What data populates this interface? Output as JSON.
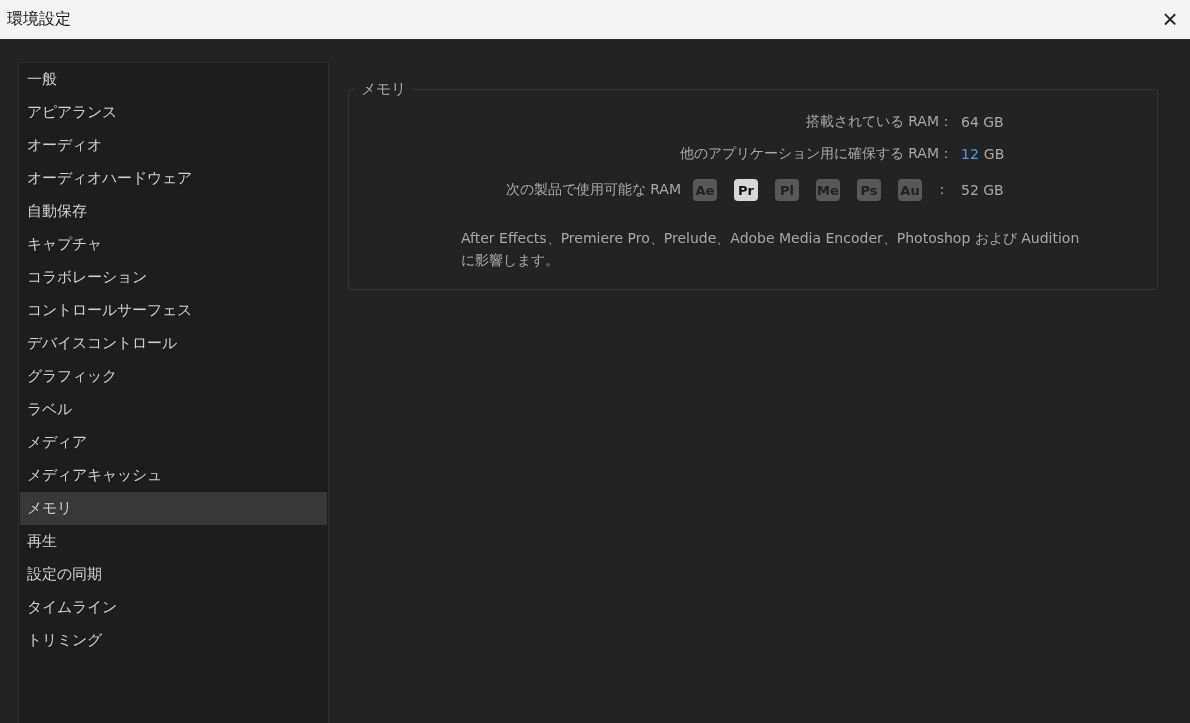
{
  "window": {
    "title": "環境設定",
    "close": "×"
  },
  "sidebar": {
    "items": [
      {
        "label": "一般",
        "selected": false
      },
      {
        "label": "アピアランス",
        "selected": false
      },
      {
        "label": "オーディオ",
        "selected": false
      },
      {
        "label": "オーディオハードウェア",
        "selected": false
      },
      {
        "label": "自動保存",
        "selected": false
      },
      {
        "label": "キャプチャ",
        "selected": false
      },
      {
        "label": "コラボレーション",
        "selected": false
      },
      {
        "label": "コントロールサーフェス",
        "selected": false
      },
      {
        "label": "デバイスコントロール",
        "selected": false
      },
      {
        "label": "グラフィック",
        "selected": false
      },
      {
        "label": "ラベル",
        "selected": false
      },
      {
        "label": "メディア",
        "selected": false
      },
      {
        "label": "メディアキャッシュ",
        "selected": false
      },
      {
        "label": "メモリ",
        "selected": true
      },
      {
        "label": "再生",
        "selected": false
      },
      {
        "label": "設定の同期",
        "selected": false
      },
      {
        "label": "タイムライン",
        "selected": false
      },
      {
        "label": "トリミング",
        "selected": false
      }
    ]
  },
  "memory": {
    "legend": "メモリ",
    "installed_label": "搭載されている RAM：",
    "installed_value": "64 GB",
    "reserved_label": "他のアプリケーション用に確保する RAM：",
    "reserved_value": "12",
    "reserved_unit": "GB",
    "available_label": "次の製品で使用可能な RAM",
    "apps": [
      {
        "label": "Ae",
        "selected": false
      },
      {
        "label": "Pr",
        "selected": true
      },
      {
        "label": "Pl",
        "selected": false
      },
      {
        "label": "Me",
        "selected": false
      },
      {
        "label": "Ps",
        "selected": false
      },
      {
        "label": "Au",
        "selected": false
      }
    ],
    "available_colon": "：",
    "available_value": "52 GB",
    "note": "After Effects、Premiere Pro、Prelude、Adobe Media Encoder、Photoshop および Audition に影響します。"
  }
}
